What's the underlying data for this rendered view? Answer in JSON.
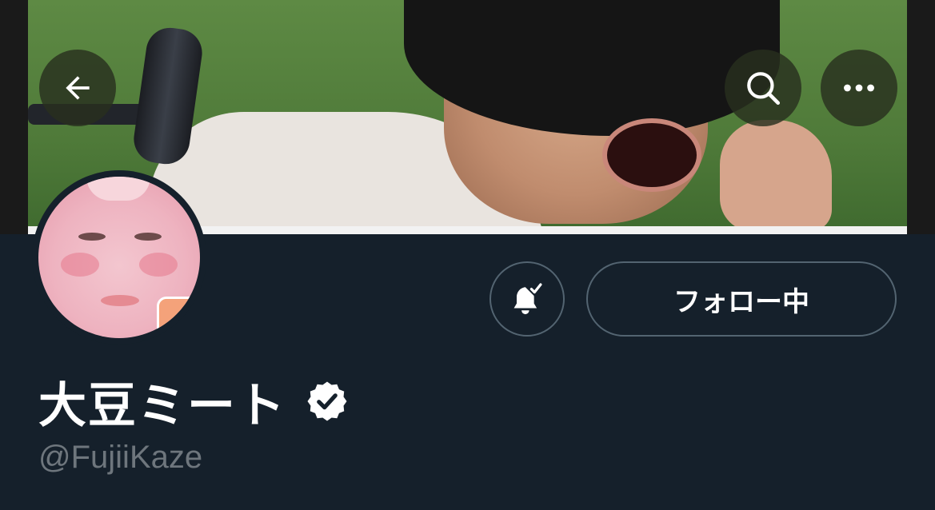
{
  "header": {
    "back_icon": "arrow-left-icon",
    "search_icon": "search-icon",
    "more_icon": "more-horizontal-icon"
  },
  "profile": {
    "display_name": "大豆ミート",
    "verified": true,
    "handle": "@FujiiKaze"
  },
  "actions": {
    "notification_icon": "bell-check-icon",
    "follow_label": "フォロー中"
  },
  "colors": {
    "background": "#15202b",
    "button_border": "#536471",
    "handle_text": "#6e767d",
    "primary_text": "#ffffff"
  }
}
